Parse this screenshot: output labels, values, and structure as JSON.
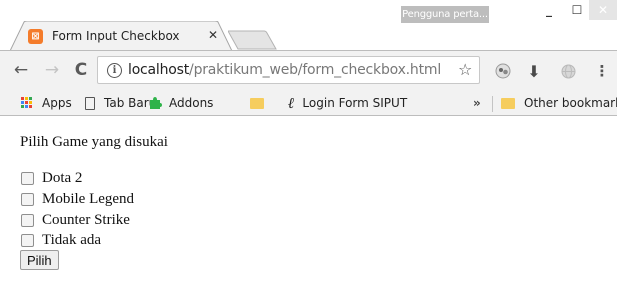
{
  "window": {
    "profile_badge": "Pengguna perta...",
    "minimize_glyph": "_",
    "maximize_glyph": "☐",
    "close_glyph": "✕"
  },
  "tab": {
    "title": "Form Input Checkbox",
    "close_glyph": "✕",
    "favicon_glyph": "⊠",
    "favicon_color": "#f47c2b"
  },
  "toolbar": {
    "back_glyph": "←",
    "forward_glyph": "→",
    "reload_glyph": "C",
    "info_glyph": "i",
    "url_host": "localhost",
    "url_path": "/praktikum_web/form_checkbox.html",
    "star_glyph": "☆",
    "download_glyph": "⬇",
    "menu_glyph": "⋮"
  },
  "bookmarks": {
    "items": [
      {
        "label": "Apps",
        "icon": "apps-grid-icon"
      },
      {
        "label": "Tab Baru",
        "icon": "page-icon"
      },
      {
        "label": "Addons",
        "icon": "puzzle-icon"
      },
      {
        "label": "",
        "icon": "folder-icon"
      },
      {
        "label": "Login Form SIPUT",
        "icon": "script-l-icon"
      }
    ],
    "overflow_glyph": "»",
    "other": "Other bookmarks"
  },
  "page": {
    "heading": "Pilih Game yang disukai",
    "options": [
      "Dota 2",
      "Mobile Legend",
      "Counter Strike",
      "Tidak ada"
    ],
    "submit_label": "Pilih"
  }
}
